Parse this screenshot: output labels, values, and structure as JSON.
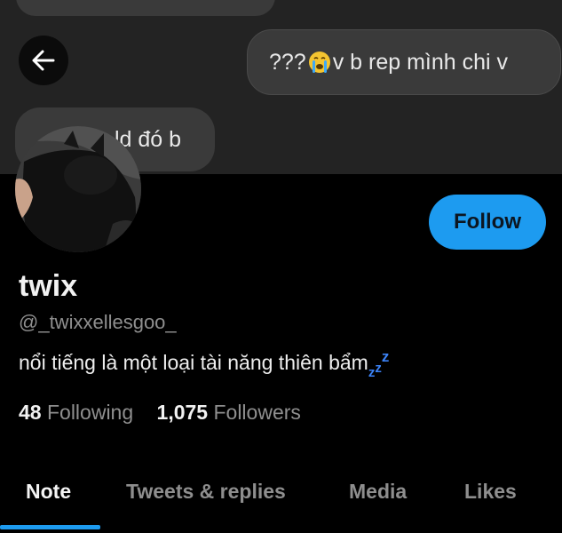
{
  "banner": {
    "messages": [
      {
        "text": ""
      },
      {
        "before": "???",
        "emoji": "loudly-crying-face-emoji",
        "after": "v b rep mình chi v"
      },
      {
        "text": "ld đó b"
      }
    ]
  },
  "back_icon": "arrow-left-icon",
  "profile": {
    "name": "twix",
    "handle": "@_twixxellesgoo_",
    "bio": "nổi tiếng là một loại tài năng thiên bẩm",
    "bio_emoji": "zzz-emoji",
    "follow_label": "Follow",
    "following_count": "48",
    "following_label": "Following",
    "followers_count": "1,075",
    "followers_label": "Followers"
  },
  "tabs": [
    {
      "label": "Note",
      "active": true
    },
    {
      "label": "Tweets & replies",
      "active": false
    },
    {
      "label": "Media",
      "active": false
    },
    {
      "label": "Likes",
      "active": false
    }
  ],
  "colors": {
    "accent": "#1d9bf0",
    "background": "#000000",
    "banner": "#232323",
    "bubble": "#3a3a3a",
    "secondary_text": "#8f8f8f"
  }
}
